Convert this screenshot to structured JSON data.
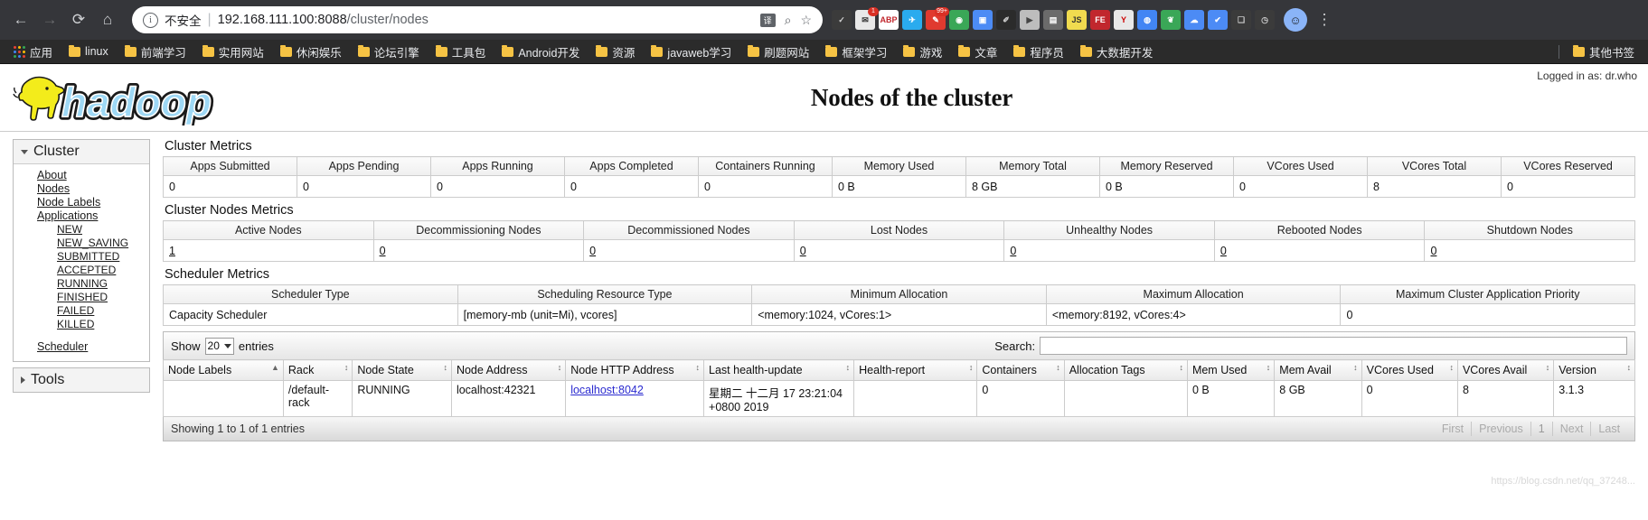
{
  "browser": {
    "nav": {
      "back": "←",
      "forward": "→",
      "reload": "⟳",
      "home": "⌂"
    },
    "omnibox": {
      "security_label": "不安全",
      "separator": "|",
      "host": "192.168.111.100:8088",
      "path": "/cluster/nodes",
      "translate_icon": "translate-icon",
      "zoom_icon": "zoom-icon",
      "bookmark_icon": "star-icon"
    },
    "extensions": [
      {
        "name": "shield-extension",
        "glyph": "✓",
        "color": "#3b3b3b",
        "text_color": "#d2d2d2",
        "badge": ""
      },
      {
        "name": "mail-extension",
        "glyph": "✉",
        "color": "#e8e8e8",
        "text_color": "#333",
        "badge": "1"
      },
      {
        "name": "adblock-plus-extension",
        "glyph": "ABP",
        "color": "#ffffff",
        "text_color": "#c1272d",
        "badge": ""
      },
      {
        "name": "telegram-extension",
        "glyph": "✈",
        "color": "#2aabee",
        "text_color": "#fff",
        "badge": ""
      },
      {
        "name": "notes-extension",
        "glyph": "✎",
        "color": "#e03a2f",
        "text_color": "#fff",
        "badge": "99+"
      },
      {
        "name": "globe-extension",
        "glyph": "◉",
        "color": "#3aa757",
        "text_color": "#fff",
        "badge": ""
      },
      {
        "name": "screenshot-extension",
        "glyph": "▣",
        "color": "#4c8bf5",
        "text_color": "#fff",
        "badge": ""
      },
      {
        "name": "pen-extension",
        "glyph": "✐",
        "color": "#2b2b2b",
        "text_color": "#ccc",
        "badge": ""
      },
      {
        "name": "video-extension",
        "glyph": "▶",
        "color": "#bdbdbd",
        "text_color": "#444",
        "badge": ""
      },
      {
        "name": "media-extension",
        "glyph": "▤",
        "color": "#6b6b6b",
        "text_color": "#fff",
        "badge": ""
      },
      {
        "name": "javascript-extension",
        "glyph": "JS",
        "color": "#f0db4f",
        "text_color": "#323330",
        "badge": ""
      },
      {
        "name": "fe-extension",
        "glyph": "FE",
        "color": "#c1272d",
        "text_color": "#fff",
        "badge": ""
      },
      {
        "name": "youdao-extension",
        "glyph": "Y",
        "color": "#e8e8e8",
        "text_color": "#c00",
        "badge": ""
      },
      {
        "name": "chrome-extension",
        "glyph": "◍",
        "color": "#4285f4",
        "text_color": "#fff",
        "badge": ""
      },
      {
        "name": "leaf-extension",
        "glyph": "❦",
        "color": "#3aa757",
        "text_color": "#fff",
        "badge": ""
      },
      {
        "name": "cloud-extension",
        "glyph": "☁",
        "color": "#4c8bf5",
        "text_color": "#fff",
        "badge": ""
      },
      {
        "name": "check-extension",
        "glyph": "✔",
        "color": "#4c8bf5",
        "text_color": "#fff",
        "badge": ""
      },
      {
        "name": "bookmark-manager-extension",
        "glyph": "❏",
        "color": "#3b3b3b",
        "text_color": "#ccc",
        "badge": ""
      },
      {
        "name": "clock-extension",
        "glyph": "◷",
        "color": "#3b3b3b",
        "text_color": "#ccc",
        "badge": ""
      }
    ],
    "avatar": {
      "name": "profile-avatar",
      "glyph": "☺"
    },
    "menu_icon": "⋮",
    "bookmarks": [
      {
        "label": "应用",
        "icon": "apps-grid-icon"
      },
      {
        "label": "linux",
        "icon": "folder-icon"
      },
      {
        "label": "前端学习",
        "icon": "folder-icon"
      },
      {
        "label": "实用网站",
        "icon": "folder-icon"
      },
      {
        "label": "休闲娱乐",
        "icon": "folder-icon"
      },
      {
        "label": "论坛引擎",
        "icon": "folder-icon"
      },
      {
        "label": "工具包",
        "icon": "folder-icon"
      },
      {
        "label": "Android开发",
        "icon": "folder-icon"
      },
      {
        "label": "资源",
        "icon": "folder-icon"
      },
      {
        "label": "javaweb学习",
        "icon": "folder-icon"
      },
      {
        "label": "刷题网站",
        "icon": "folder-icon"
      },
      {
        "label": "框架学习",
        "icon": "folder-icon"
      },
      {
        "label": "游戏",
        "icon": "folder-icon"
      },
      {
        "label": "文章",
        "icon": "folder-icon"
      },
      {
        "label": "程序员",
        "icon": "folder-icon"
      },
      {
        "label": "大数据开发",
        "icon": "folder-icon"
      }
    ],
    "bookmarks_overflow": {
      "label": "其他书签",
      "icon": "folder-icon"
    }
  },
  "header": {
    "logo_alt": "hadoop",
    "title": "Nodes of the cluster",
    "logged_in": "Logged in as: dr.who"
  },
  "sidebar": {
    "cluster": {
      "title": "Cluster",
      "links": [
        "About",
        "Nodes",
        "Node Labels",
        "Applications"
      ],
      "app_states": [
        "NEW",
        "NEW_SAVING",
        "SUBMITTED",
        "ACCEPTED",
        "RUNNING",
        "FINISHED",
        "FAILED",
        "KILLED"
      ],
      "scheduler": "Scheduler"
    },
    "tools": {
      "title": "Tools"
    }
  },
  "cluster_metrics": {
    "title": "Cluster Metrics",
    "columns": [
      "Apps Submitted",
      "Apps Pending",
      "Apps Running",
      "Apps Completed",
      "Containers Running",
      "Memory Used",
      "Memory Total",
      "Memory Reserved",
      "VCores Used",
      "VCores Total",
      "VCores Reserved"
    ],
    "values": [
      "0",
      "0",
      "0",
      "0",
      "0",
      "0 B",
      "8 GB",
      "0 B",
      "0",
      "8",
      "0"
    ]
  },
  "cluster_nodes_metrics": {
    "title": "Cluster Nodes Metrics",
    "columns": [
      "Active Nodes",
      "Decommissioning Nodes",
      "Decommissioned Nodes",
      "Lost Nodes",
      "Unhealthy Nodes",
      "Rebooted Nodes",
      "Shutdown Nodes"
    ],
    "values": [
      "1",
      "0",
      "0",
      "0",
      "0",
      "0",
      "0"
    ]
  },
  "scheduler_metrics": {
    "title": "Scheduler Metrics",
    "columns": [
      "Scheduler Type",
      "Scheduling Resource Type",
      "Minimum Allocation",
      "Maximum Allocation",
      "Maximum Cluster Application Priority"
    ],
    "values": [
      "Capacity Scheduler",
      "[memory-mb (unit=Mi), vcores]",
      "<memory:1024, vCores:1>",
      "<memory:8192, vCores:4>",
      "0"
    ]
  },
  "datatable": {
    "show_label": "Show",
    "entries_label": "entries",
    "page_length": "20",
    "search_label": "Search:",
    "search_value": "",
    "search_placeholder": "",
    "columns": [
      "Node Labels",
      "Rack",
      "Node State",
      "Node Address",
      "Node HTTP Address",
      "Last health-update",
      "Health-report",
      "Containers",
      "Allocation Tags",
      "Mem Used",
      "Mem Avail",
      "VCores Used",
      "VCores Avail",
      "Version"
    ],
    "rows": [
      {
        "node_labels": "",
        "rack": "/default-rack",
        "node_state": "RUNNING",
        "node_address": "localhost:42321",
        "node_http_address": "localhost:8042",
        "last_health_update": "星期二 十二月 17 23:21:04 +0800 2019",
        "health_report": "",
        "containers": "0",
        "allocation_tags": "",
        "mem_used": "0 B",
        "mem_avail": "8 GB",
        "vcores_used": "0",
        "vcores_avail": "8",
        "version": "3.1.3"
      }
    ],
    "info": "Showing 1 to 1 of 1 entries",
    "pager": [
      "First",
      "Previous",
      "1",
      "Next",
      "Last"
    ]
  },
  "watermark": "https://blog.csdn.net/qq_37248..."
}
